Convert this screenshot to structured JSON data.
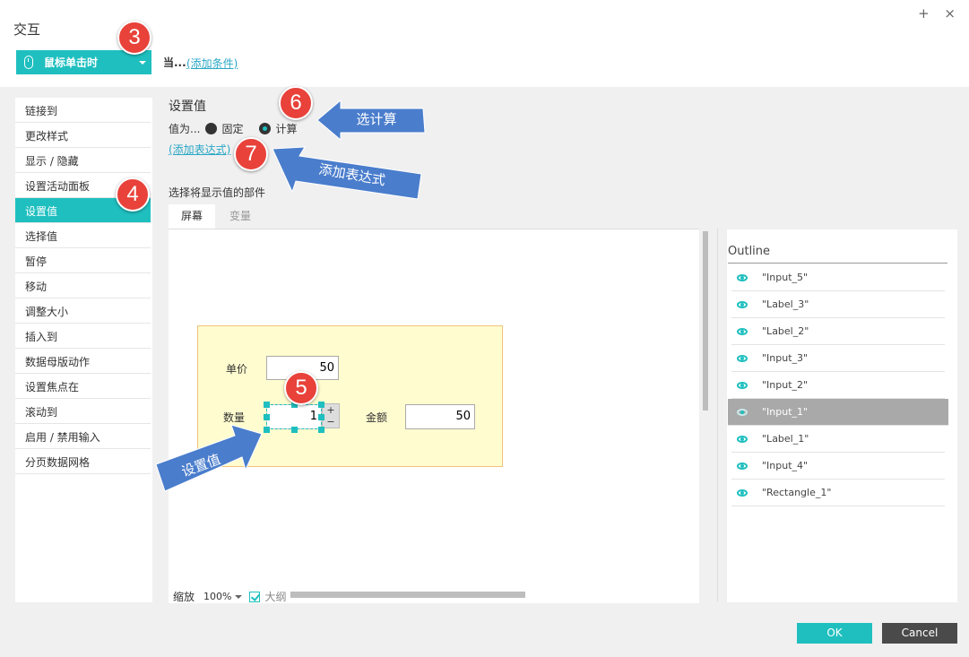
{
  "dialog": {
    "title": "交互",
    "window_buttons": "+ ×"
  },
  "event": {
    "selected": "鼠标单击时",
    "when_label": "当...",
    "add_condition": "(添加条件)"
  },
  "actions": [
    "链接到",
    "更改样式",
    "显示 / 隐藏",
    "设置活动面板",
    "设置值",
    "选择值",
    "暂停",
    "移动",
    "调整大小",
    "插入到",
    "数据母版动作",
    "设置焦点在",
    "滚动到",
    "启用 / 禁用输入",
    "分页数据网格"
  ],
  "active_action": "设置值",
  "setvalue": {
    "title": "设置值",
    "value_as": "值为...",
    "option_fixed": "固定",
    "option_calc": "计算",
    "add_expression": "(添加表达式)",
    "pick_label": "选择将显示值的部件",
    "tab_screen": "屏幕",
    "tab_variable": "变量"
  },
  "prototype": {
    "unit_price_label": "单价",
    "unit_price_value": "50",
    "qty_label": "数量",
    "qty_value": "1",
    "stepper_plus": "+",
    "stepper_minus": "−",
    "amount_label": "金额",
    "amount_value": "50"
  },
  "outline": {
    "title": "Outline",
    "items": [
      "\"Input_5\"",
      "\"Label_3\"",
      "\"Label_2\"",
      "\"Input_3\"",
      "\"Input_2\"",
      "\"Input_1\"",
      "\"Label_1\"",
      "\"Input_4\"",
      "\"Rectangle_1\""
    ],
    "selected": "\"Input_1\""
  },
  "zoom": {
    "label": "缩放",
    "value": "100%",
    "outline_toggle": "大纲"
  },
  "buttons": {
    "ok": "OK",
    "cancel": "Cancel"
  },
  "annotations": {
    "badge_3": "3",
    "badge_4": "4",
    "badge_5": "5",
    "badge_6": "6",
    "badge_7": "7",
    "arrow_calc": "选计算",
    "arrow_expr": "添加表达式",
    "arrow_set": "设置值"
  },
  "colors": {
    "accent": "#1fbfbf",
    "badge": "#e8423a",
    "callout": "#4a7dcc"
  }
}
